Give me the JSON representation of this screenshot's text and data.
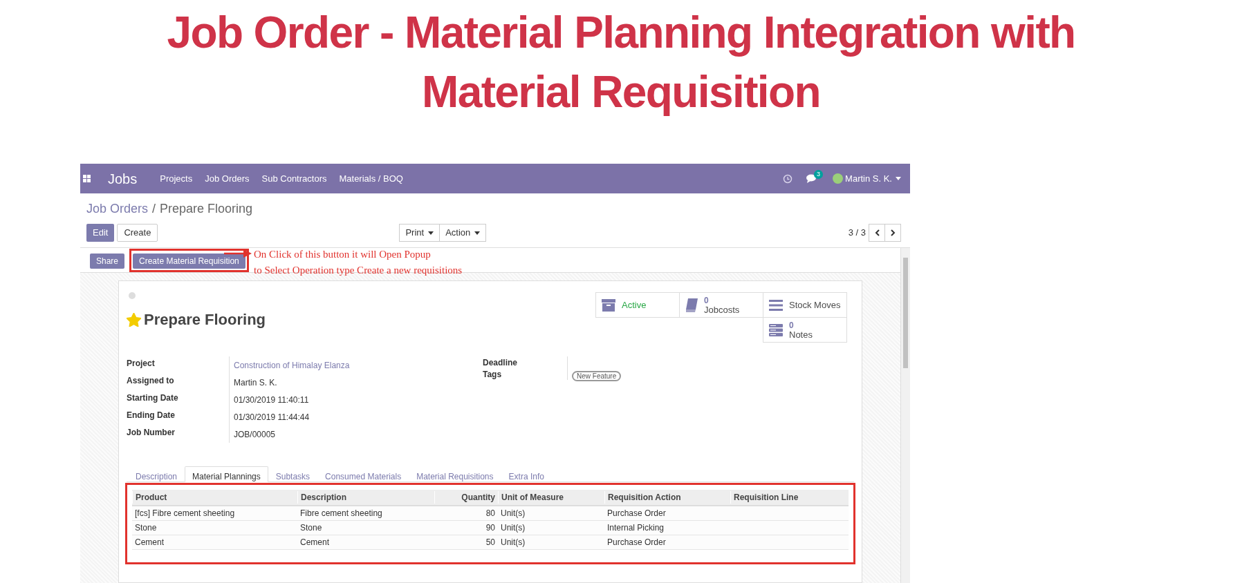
{
  "headline": "Job Order - Material Planning Integration with Material Requisition",
  "navbar": {
    "app": "Jobs",
    "menu": [
      "Projects",
      "Job Orders",
      "Sub Contractors",
      "Materials / BOQ"
    ],
    "chat_count": "3",
    "user": "Martin S. K."
  },
  "breadcrumb": {
    "parent": "Job Orders",
    "separator": "/",
    "current": "Prepare Flooring"
  },
  "buttons": [
    "Edit",
    "Create"
  ],
  "dropdowns": [
    "Print",
    "Action"
  ],
  "pager": "3 / 3",
  "header_buttons": [
    {
      "label": "Share",
      "highlighted": false
    },
    {
      "label": "Create Material Requisition",
      "highlighted": true
    }
  ],
  "annotation": [
    "On Click of this button it will Open Popup",
    "to Select Operation type Create a new requisitions"
  ],
  "record": {
    "starred": true,
    "title": "Prepare Flooring"
  },
  "smart_buttons": [
    {
      "kind": "status",
      "label": "Active"
    },
    {
      "kind": "counter",
      "count": "0",
      "label": "Jobcosts"
    },
    {
      "kind": "plain",
      "label": "Stock Moves"
    },
    {
      "kind": "counter",
      "count": "0",
      "label": "Notes"
    }
  ],
  "fields_left": [
    {
      "label": "Project",
      "value": "Construction of Himalay Elanza",
      "kind": "link"
    },
    {
      "label": "Assigned to",
      "value": "Martin S. K.",
      "kind": "text"
    },
    {
      "label": "Starting Date",
      "value": "01/30/2019 11:40:11",
      "kind": "text"
    },
    {
      "label": "Ending Date",
      "value": "01/30/2019 11:44:44",
      "kind": "text"
    },
    {
      "label": "Job Number",
      "value": "JOB/00005",
      "kind": "text"
    }
  ],
  "fields_right": [
    {
      "label": "Deadline"
    },
    {
      "label": "Tags",
      "tags": [
        "New Feature"
      ]
    }
  ],
  "tabs": [
    {
      "label": "Description",
      "selected": false
    },
    {
      "label": "Material Plannings",
      "selected": true
    },
    {
      "label": "Subtasks",
      "selected": false
    },
    {
      "label": "Consumed Materials",
      "selected": false
    },
    {
      "label": "Material Requisitions",
      "selected": false
    },
    {
      "label": "Extra Info",
      "selected": false
    }
  ],
  "table": {
    "highlighted": true,
    "columns": [
      "Product",
      "Description",
      "Quantity",
      "Unit of Measure",
      "Requisition Action",
      "Requisition Line"
    ],
    "rows": [
      [
        "[fcs] Fibre cement sheeting",
        "Fibre cement sheeting",
        "80",
        "Unit(s)",
        "Purchase Order"
      ],
      [
        "Stone",
        "Stone",
        "90",
        "Unit(s)",
        "Internal Picking"
      ],
      [
        "Cement",
        "Cement",
        "50",
        "Unit(s)",
        "Purchase Order"
      ]
    ]
  }
}
